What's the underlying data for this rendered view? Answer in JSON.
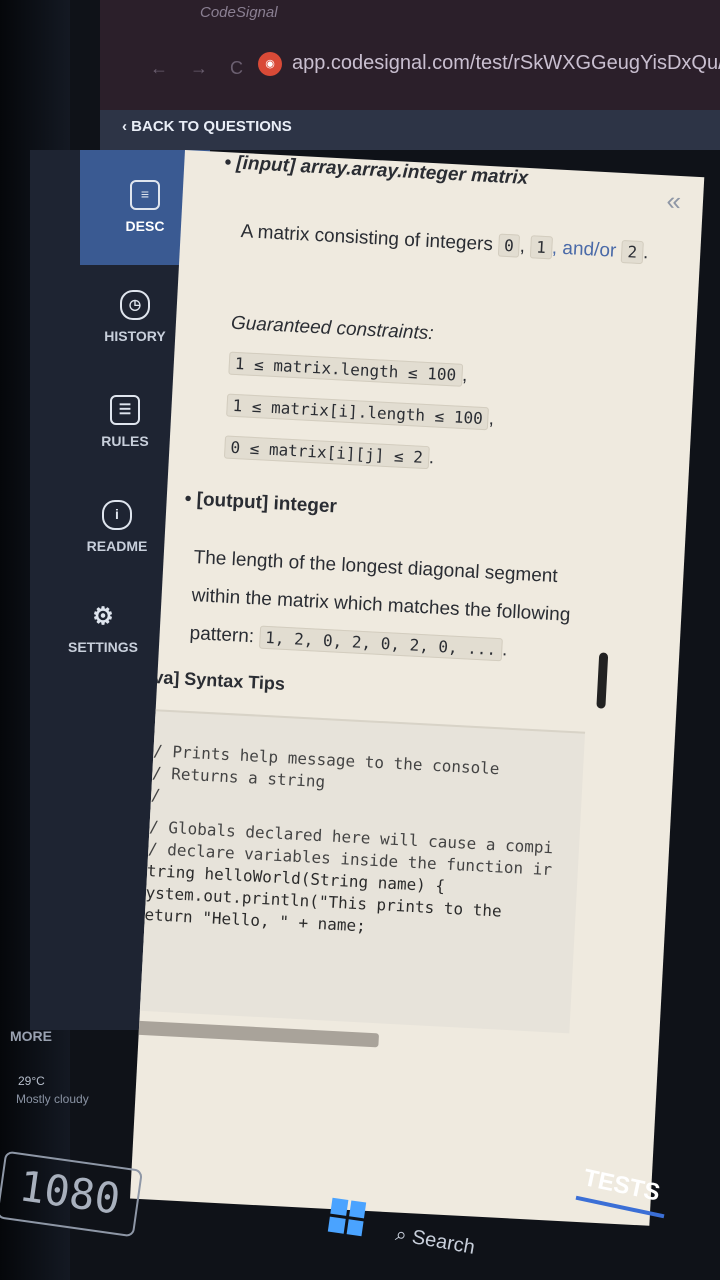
{
  "browser": {
    "tab_title": "CodeSignal",
    "url": "app.codesignal.com/test/rSkWXGGeugYisDxQu/"
  },
  "nav": {
    "back_label": "BACK TO QUESTIONS"
  },
  "sidebar": {
    "items": [
      {
        "label": "DESC",
        "icon": "document-icon",
        "active": true
      },
      {
        "label": "HISTORY",
        "icon": "clock-icon"
      },
      {
        "label": "RULES",
        "icon": "list-icon"
      },
      {
        "label": "README",
        "icon": "info-icon"
      },
      {
        "label": "SETTINGS",
        "icon": "gear-icon"
      }
    ]
  },
  "description": {
    "collapse_glyph": "«",
    "input_title": "[input] array.array.integer matrix",
    "input_text": "A matrix consisting of integers",
    "input_codes": [
      "0",
      "1",
      "2"
    ],
    "input_sep1": ",",
    "input_andor": ", and/or",
    "input_end": ".",
    "constraints_label": "Guaranteed constraints:",
    "constraints": [
      "1 ≤ matrix.length ≤ 100",
      "1 ≤ matrix[i].length ≤ 100",
      "0 ≤ matrix[i][j] ≤ 2"
    ],
    "constraint_seps": [
      ",",
      ",",
      "."
    ],
    "output_title": "[output] integer",
    "output_line1": "The length of the longest diagonal segment",
    "output_line2": "within the matrix which matches the following",
    "output_line3": "pattern:",
    "output_pattern": "1, 2, 0, 2, 0, 2, 0, ...",
    "output_end": "."
  },
  "syntax_tips": {
    "title": "[Java] Syntax Tips",
    "lines": [
      "// Prints help message to the console",
      "// Returns a string",
      "//",
      "// Globals declared here will cause a compi",
      "// declare variables inside the function ir",
      "String helloWorld(String name) {",
      "    System.out.println(\"This prints to the",
      "    return \"Hello, \" + name;",
      "}"
    ]
  },
  "footer": {
    "tests_label": "TESTS",
    "more_label": "MORE",
    "weather_temp": "29°C",
    "weather_desc": "Mostly cloudy",
    "resolution": "1080",
    "search_label": "Search"
  },
  "colors": {
    "sidebar_bg": "#1e2432",
    "active_tab": "#3a5a92",
    "panel_bg": "#efeadf",
    "accent_blue": "#3b6fd6"
  }
}
